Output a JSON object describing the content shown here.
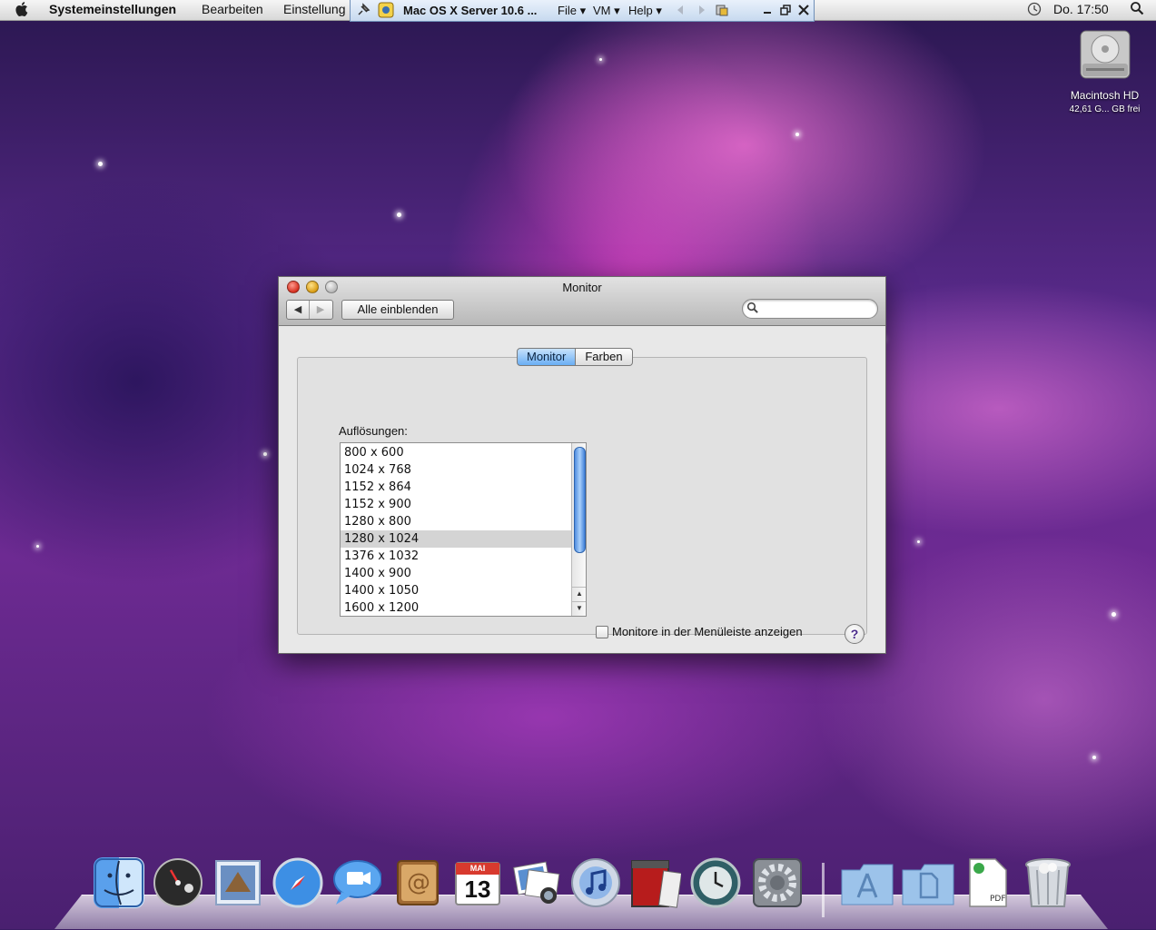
{
  "menubar": {
    "app_name": "Systemeinstellungen",
    "items": [
      "Bearbeiten",
      "Einstellung"
    ],
    "clock": "Do. 17:50"
  },
  "vmware_bar": {
    "title": "Mac OS X Server 10.6 ...",
    "menus": [
      "File",
      "VM",
      "Help"
    ]
  },
  "desktop": {
    "drive_name": "Macintosh HD",
    "drive_info": "42,61 G... GB frei"
  },
  "window": {
    "title": "Monitor",
    "show_all_label": "Alle einblenden",
    "search_placeholder": "",
    "tabs": [
      "Monitor",
      "Farben"
    ],
    "active_tab": "Monitor",
    "resolutions_label": "Auflösungen:",
    "resolutions": [
      "800 x 600",
      "1024 x 768",
      "1152 x 864",
      "1152 x 900",
      "1280 x 800",
      "1280 x 1024",
      "1376 x 1032",
      "1400 x 900",
      "1400 x 1050",
      "1600 x 1200"
    ],
    "selected_resolution": "1280 x 1024",
    "menubar_checkbox_label": "Monitore in der Menüleiste anzeigen",
    "menubar_checkbox_checked": false,
    "help_label": "?"
  },
  "dock": {
    "items": [
      "finder-icon",
      "dashboard-icon",
      "mail-icon",
      "safari-icon",
      "ichat-icon",
      "address-book-icon",
      "ical-icon",
      "iphoto-icon",
      "itunes-icon",
      "photo-booth-icon",
      "time-machine-icon",
      "system-preferences-icon",
      "applications-folder-icon",
      "documents-folder-icon",
      "pdf-document-icon",
      "trash-icon"
    ],
    "calendar_month": "MAI",
    "calendar_day": "13"
  }
}
